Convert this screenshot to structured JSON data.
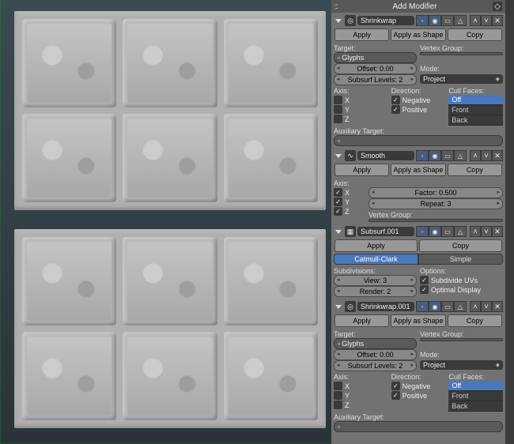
{
  "panel_title": "Add Modifier",
  "modifiers": [
    {
      "name": "Shrinkwrap",
      "apply": "Apply",
      "apply_shape": "Apply as Shape",
      "copy": "Copy",
      "target_label": "Target:",
      "target_value": "Glyphs",
      "vgroup_label": "Vertex Group:",
      "vgroup_value": "",
      "offset": "Offset: 0.00",
      "mode_label": "Mode:",
      "sslevels": "Subsurf Levels: 2",
      "mode_value": "Project",
      "axis_label": "Axis:",
      "axis": [
        "X",
        "Y",
        "Z"
      ],
      "dir_label": "Direction:",
      "dir_neg": "Negative",
      "dir_pos": "Positive",
      "cull_label": "Cull Faces:",
      "cull_items": [
        "Off",
        "Front",
        "Back"
      ],
      "aux_label": "Auxiliary Target:",
      "aux_value": ""
    },
    {
      "name": "Smooth",
      "apply": "Apply",
      "apply_shape": "Apply as Shape",
      "copy": "Copy",
      "axis_label": "Axis:",
      "axis": [
        "X",
        "Y",
        "Z"
      ],
      "factor": "Factor: 0.500",
      "repeat": "Repeat: 3",
      "vgroup_label": "Vertex Group:",
      "vgroup_value": ""
    },
    {
      "name": "Subsurf.001",
      "apply": "Apply",
      "copy": "Copy",
      "type_a": "Catmull-Clark",
      "type_b": "Simple",
      "subdiv_label": "Subdivisions:",
      "view": "View: 3",
      "render": "Render: 2",
      "options_label": "Options:",
      "opt_uv": "Subdivide UVs",
      "opt_disp": "Optimal Display"
    },
    {
      "name": "Shrinkwrap.001",
      "apply": "Apply",
      "apply_shape": "Apply as Shape",
      "copy": "Copy",
      "target_label": "Target:",
      "target_value": "Glyphs",
      "vgroup_label": "Vertex Group:",
      "vgroup_value": "",
      "offset": "Offset: 0.00",
      "mode_label": "Mode:",
      "sslevels": "Subsurf Levels: 2",
      "mode_value": "Project",
      "axis_label": "Axis:",
      "axis": [
        "X",
        "Y",
        "Z"
      ],
      "dir_label": "Direction:",
      "dir_neg": "Negative",
      "dir_pos": "Positive",
      "cull_label": "Cull Faces:",
      "cull_items": [
        "Off",
        "Front",
        "Back"
      ],
      "aux_label": "Auxiliary Target:",
      "aux_value": ""
    }
  ]
}
